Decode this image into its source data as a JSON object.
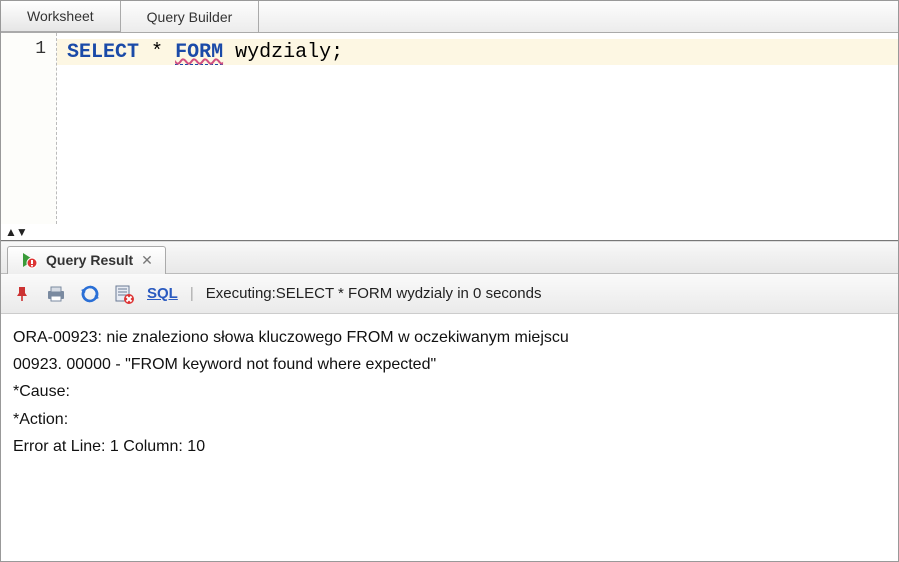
{
  "tabs": {
    "worksheet": "Worksheet",
    "query_builder": "Query Builder"
  },
  "editor": {
    "line_number": "1",
    "sql": {
      "select": "SELECT",
      "star": "*",
      "form": "FORM",
      "table": "wydzialy",
      "semicolon": ";"
    }
  },
  "result": {
    "tab_label": "Query Result",
    "sql_link": "SQL",
    "status": "Executing:SELECT * FORM wydzialy in 0 seconds",
    "error_lines": {
      "l1": "ORA-00923: nie znaleziono słowa kluczowego FROM w oczekiwanym miejscu",
      "l2": "00923. 00000 -  \"FROM keyword not found where expected\"",
      "l3": "*Cause:",
      "l4": "*Action:",
      "l5": "Error at Line: 1 Column: 10"
    }
  }
}
